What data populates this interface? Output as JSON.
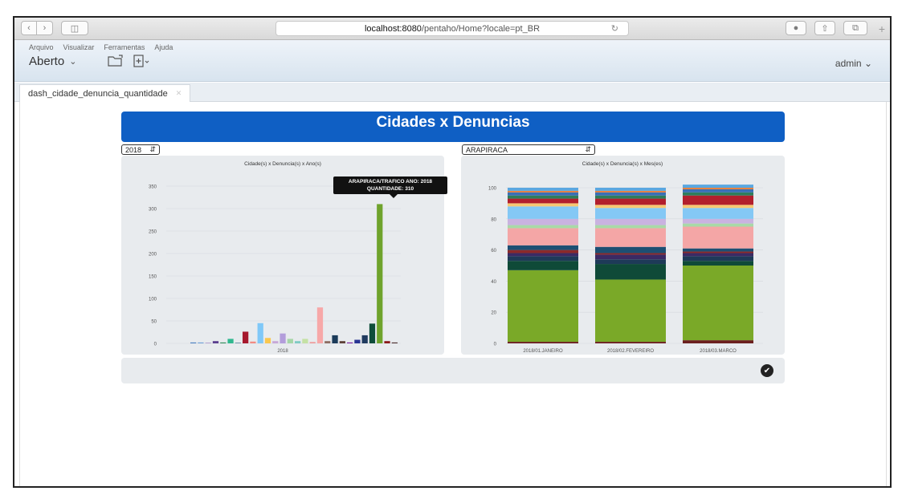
{
  "browser": {
    "url_host": "localhost:8080",
    "url_path": "/pentaho/Home?locale=pt_BR"
  },
  "app": {
    "menu": [
      "Arquivo",
      "Visualizar",
      "Ferramentas",
      "Ajuda"
    ],
    "perspective": "Aberto",
    "user": "admin"
  },
  "tab": {
    "label": "dash_cidade_denuncia_quantidade"
  },
  "dashboard": {
    "title": "Cidades x Denuncias",
    "year_select": "2018",
    "city_select": "ARAPIRACA"
  },
  "tooltip": {
    "line1": "ARAPIRACA/TRAFICO ANO: 2018",
    "line2": "QUANTIDADE: 310"
  },
  "chart_data": [
    {
      "type": "bar",
      "title": "Cidade(s) x Denuncia(s) x Ano(s)",
      "categories": [
        "2018"
      ],
      "ylim": [
        0,
        350
      ],
      "yticks": [
        0,
        50,
        100,
        150,
        200,
        250,
        300,
        350
      ],
      "grid": true,
      "values": [
        2,
        2,
        1,
        5,
        2,
        10,
        1,
        26,
        4,
        45,
        12,
        5,
        22,
        10,
        5,
        10,
        3,
        80,
        5,
        18,
        5,
        2,
        8,
        18,
        44,
        310,
        5,
        2
      ],
      "colors": [
        "#4a7fc1",
        "#6fa0d8",
        "#8e6bb7",
        "#5b3f8f",
        "#2e8b57",
        "#30b88f",
        "#1a5276",
        "#a6192e",
        "#f28b82",
        "#7fc8f8",
        "#f9c74f",
        "#c7a8d8",
        "#b39ddb",
        "#a5d6a7",
        "#80cbc4",
        "#c5e1a5",
        "#ef9a9a",
        "#f7a8a8",
        "#8d6e63",
        "#1b3b5a",
        "#5d4037",
        "#7b1fa2",
        "#283593",
        "#1f3a5f",
        "#0e4d3a",
        "#6fa32c",
        "#8b1a1a",
        "#4b2e2e"
      ]
    },
    {
      "type": "bar",
      "title": "Cidade(s) x Denuncia(s) x Mes(es)",
      "categories": [
        "2018/01.JANEIRO",
        "2018/02.FEVEREIRO",
        "2018/03.MARCO"
      ],
      "ylim": [
        0,
        100
      ],
      "yticks": [
        0,
        20,
        40,
        60,
        80,
        100
      ],
      "grid": true,
      "stacked": true,
      "series": [
        {
          "color": "#6b1f1f",
          "values": [
            1,
            1,
            2
          ]
        },
        {
          "color": "#7aa928",
          "values": [
            46,
            40,
            48
          ]
        },
        {
          "color": "#0f4a38",
          "values": [
            6,
            10,
            3
          ]
        },
        {
          "color": "#1e3a58",
          "values": [
            3,
            3,
            3
          ]
        },
        {
          "color": "#3b2a64",
          "values": [
            2,
            3,
            2
          ]
        },
        {
          "color": "#8b2a2a",
          "values": [
            2,
            1,
            1
          ]
        },
        {
          "color": "#1d4f73",
          "values": [
            3,
            4,
            2
          ]
        },
        {
          "color": "#f4a6a6",
          "values": [
            11,
            12,
            14
          ]
        },
        {
          "color": "#a8d9a7",
          "values": [
            2,
            2,
            2
          ]
        },
        {
          "color": "#c9b3e0",
          "values": [
            4,
            4,
            3
          ]
        },
        {
          "color": "#84c8f5",
          "values": [
            8,
            7,
            7
          ]
        },
        {
          "color": "#f7c873",
          "values": [
            2,
            2,
            2
          ]
        },
        {
          "color": "#b21f2d",
          "values": [
            3,
            4,
            6
          ]
        },
        {
          "color": "#2e7d5b",
          "values": [
            2,
            2,
            2
          ]
        },
        {
          "color": "#3a6fb5",
          "values": [
            2,
            2,
            2
          ]
        },
        {
          "color": "#e87f3a",
          "values": [
            1,
            1,
            1
          ]
        },
        {
          "color": "#5aa7e0",
          "values": [
            2,
            2,
            2
          ]
        }
      ]
    }
  ]
}
